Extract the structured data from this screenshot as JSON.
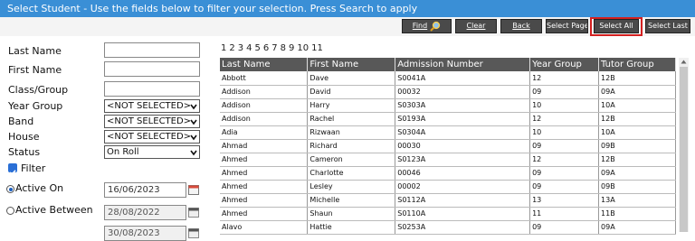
{
  "title": "Select Student   -   Use the fields below to filter your selection. Press Search to apply",
  "toolbar": {
    "find": "Find",
    "clear": "Clear",
    "back": "Back",
    "select_page": "Select Page",
    "select_all": "Select All",
    "select_last": "Select Last"
  },
  "filters": {
    "last_name": {
      "label": "Last Name",
      "value": ""
    },
    "first_name": {
      "label": "First Name",
      "value": ""
    },
    "class_group": {
      "label": "Class/Group",
      "value": ""
    },
    "year_group": {
      "label": "Year Group",
      "value": "<NOT SELECTED>"
    },
    "band": {
      "label": "Band",
      "value": "<NOT SELECTED>"
    },
    "house": {
      "label": "House",
      "value": "<NOT SELECTED>"
    },
    "status": {
      "label": "Status",
      "value": "On Roll"
    },
    "filter": {
      "label": "Filter",
      "checked": true
    },
    "active_on": {
      "label": "Active On",
      "value": "16/06/2023",
      "selected": true
    },
    "active_between": {
      "label": "Active Between",
      "from": "28/08/2022",
      "to": "30/08/2023"
    }
  },
  "pager": [
    "1",
    "2",
    "3",
    "4",
    "5",
    "6",
    "7",
    "8",
    "9",
    "10",
    "11"
  ],
  "table": {
    "headers": [
      "Last Name",
      "First Name",
      "Admission Number",
      "Year Group",
      "Tutor Group"
    ],
    "rows": [
      [
        "Abbott",
        "Dave",
        "S0041A",
        "12",
        "12B"
      ],
      [
        "Addison",
        "David",
        "00032",
        "09",
        "09A"
      ],
      [
        "Addison",
        "Harry",
        "S0303A",
        "10",
        "10A"
      ],
      [
        "Addison",
        "Rachel",
        "S0193A",
        "12",
        "12B"
      ],
      [
        "Adia",
        "Rizwaan",
        "S0304A",
        "10",
        "10A"
      ],
      [
        "Ahmad",
        "Richard",
        "00030",
        "09",
        "09B"
      ],
      [
        "Ahmed",
        "Cameron",
        "S0123A",
        "12",
        "12B"
      ],
      [
        "Ahmed",
        "Charlotte",
        "00046",
        "09",
        "09A"
      ],
      [
        "Ahmed",
        "Lesley",
        "00002",
        "09",
        "09B"
      ],
      [
        "Ahmed",
        "Michelle",
        "S0112A",
        "13",
        "13A"
      ],
      [
        "Ahmed",
        "Shaun",
        "S0110A",
        "11",
        "11B"
      ],
      [
        "Alavo",
        "Hattie",
        "S0253A",
        "09",
        "09A"
      ]
    ]
  },
  "colors": {
    "title_bar": "#3a8fd6",
    "header": "#585858",
    "highlight": "#d42020"
  }
}
